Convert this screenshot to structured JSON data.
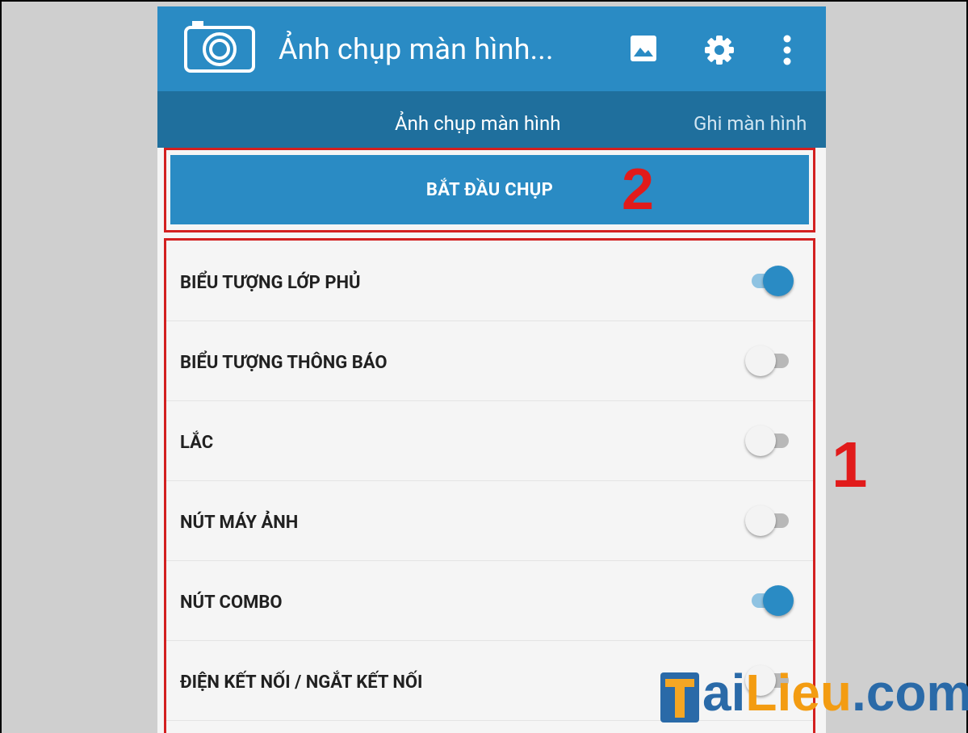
{
  "app_bar": {
    "title": "Ảnh chụp màn hình...",
    "icons": [
      "camera-icon",
      "image-icon",
      "gear-icon",
      "more-vertical-icon"
    ]
  },
  "tabs": [
    {
      "label": "Ảnh chụp màn hình",
      "active": true
    },
    {
      "label": "Ghi màn hình",
      "active": false
    }
  ],
  "start_button": {
    "label": "BẮT ĐẦU CHỤP"
  },
  "settings": [
    {
      "label": "BIỂU TƯỢNG LỚP PHỦ",
      "enabled": true
    },
    {
      "label": "BIỂU TƯỢNG THÔNG BÁO",
      "enabled": false
    },
    {
      "label": "LẮC",
      "enabled": false
    },
    {
      "label": "NÚT MÁY ẢNH",
      "enabled": false
    },
    {
      "label": "NÚT COMBO",
      "enabled": true
    },
    {
      "label": "ĐIỆN KẾT NỐI / NGẮT KẾT NỐI",
      "enabled": false
    }
  ],
  "annotations": {
    "step_1": "1",
    "step_2": "2"
  },
  "watermark": {
    "t": "T",
    "ai": "ai",
    "lieu": "Lieu",
    "com": ".com"
  },
  "colors": {
    "primary": "#2a8bc4",
    "tab_bar": "#1f6f9d",
    "highlight_red": "#d32020",
    "toggle_track_on": "#8fc3e2"
  }
}
